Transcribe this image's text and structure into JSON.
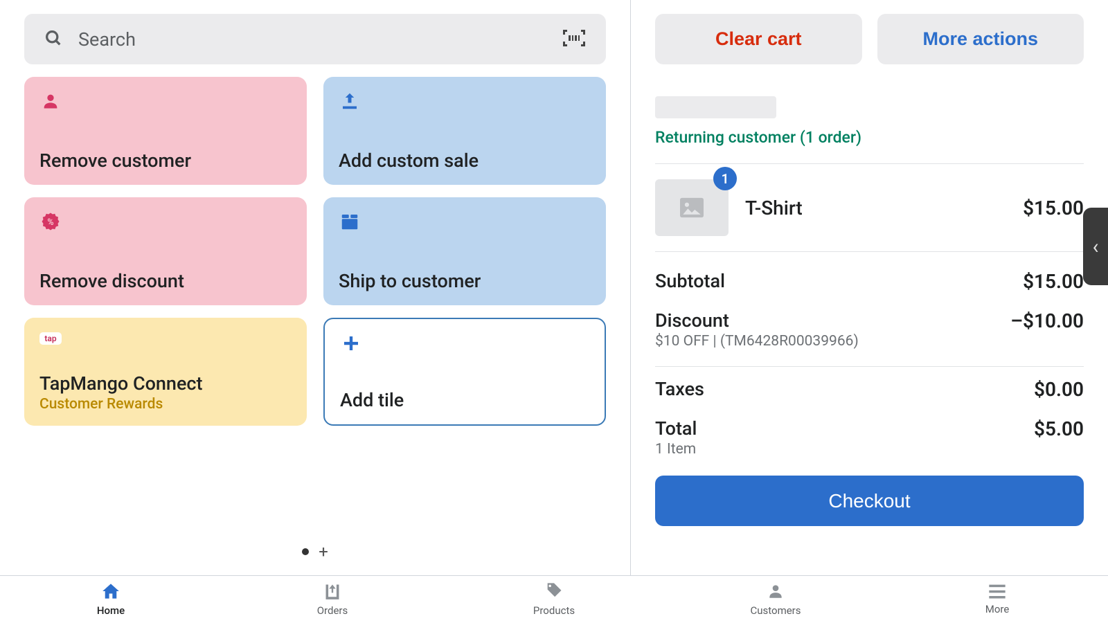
{
  "search": {
    "placeholder": "Search"
  },
  "tiles": {
    "remove_customer": "Remove customer",
    "add_custom_sale": "Add custom sale",
    "remove_discount": "Remove discount",
    "ship_to_customer": "Ship to customer",
    "tapmango_title": "TapMango Connect",
    "tapmango_sub": "Customer Rewards",
    "tapmango_chip": "tap",
    "add_tile": "Add tile"
  },
  "actions": {
    "clear_cart": "Clear cart",
    "more_actions": "More actions"
  },
  "customer": {
    "status": "Returning customer (1 order)"
  },
  "cart": {
    "items": [
      {
        "qty": "1",
        "name": "T-Shirt",
        "price": "$15.00"
      }
    ]
  },
  "totals": {
    "subtotal_label": "Subtotal",
    "subtotal": "$15.00",
    "discount_label": "Discount",
    "discount_detail": "$10 OFF | (TM6428R00039966)",
    "discount_amount": "–$10.00",
    "taxes_label": "Taxes",
    "taxes": "$0.00",
    "total_label": "Total",
    "total_sub": "1 Item",
    "total": "$5.00"
  },
  "checkout": "Checkout",
  "nav": {
    "home": "Home",
    "orders": "Orders",
    "products": "Products",
    "customers": "Customers",
    "more": "More"
  }
}
